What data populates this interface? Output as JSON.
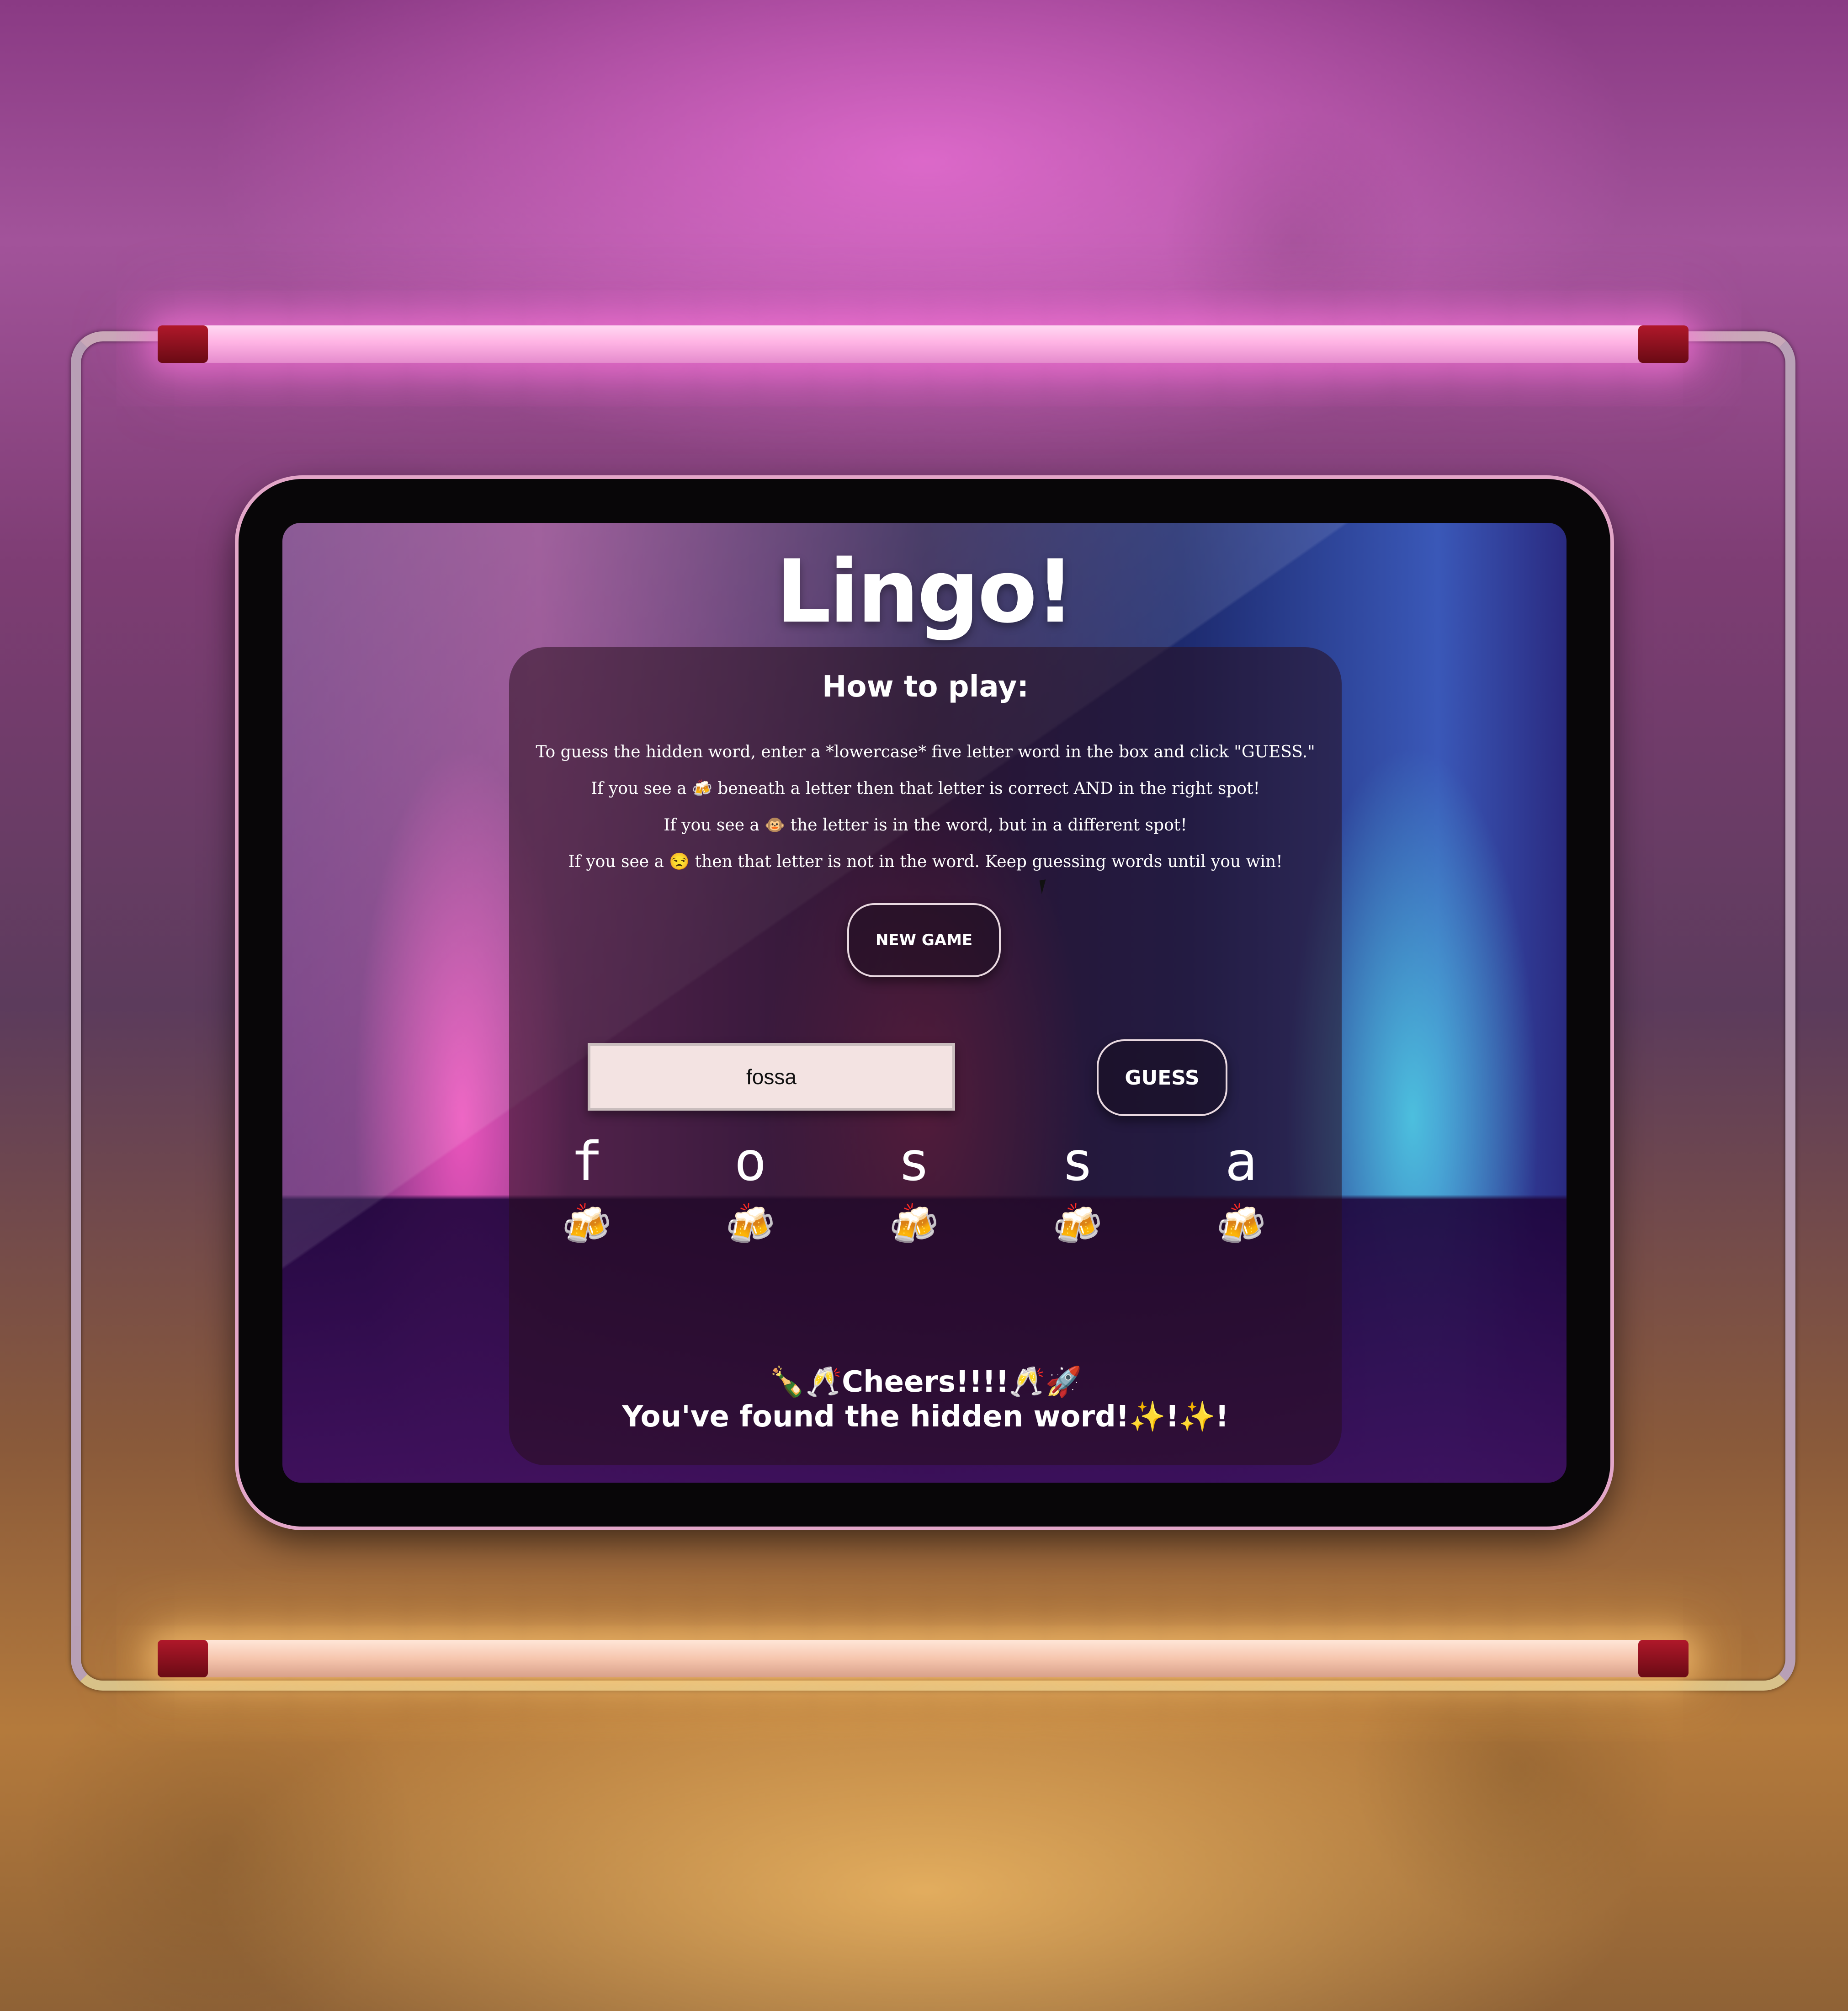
{
  "app": {
    "title": "Lingo!"
  },
  "howto": {
    "title": "How to play:",
    "rules": [
      "To guess the hidden word, enter a *lowercase* five letter word in the box and click \"GUESS.\"",
      "If you see a 🍻 beneath a letter then that letter is correct AND in the right spot!",
      "If you see a 🐵 the letter is in the word, but in a different spot!",
      "If you see a 😒 then that letter is not in the word. Keep guessing words until you win!"
    ]
  },
  "buttons": {
    "new_game": "NEW GAME",
    "guess": "GUESS"
  },
  "input": {
    "value": "fossa",
    "placeholder": ""
  },
  "letters": [
    {
      "char": "f",
      "mark": "🍻"
    },
    {
      "char": "o",
      "mark": "🍻"
    },
    {
      "char": "s",
      "mark": "🍻"
    },
    {
      "char": "s",
      "mark": "🍻"
    },
    {
      "char": "a",
      "mark": "🍻"
    }
  ],
  "result": {
    "line1": "🍾🥂Cheers!!!!🥂🚀",
    "line2": "You've found the hidden word!✨!✨!"
  },
  "colors": {
    "neon_top": "#ffb4e4",
    "neon_bottom": "#f6c6ae",
    "panel": "#28101e",
    "input_bg": "#f3e3e2"
  }
}
